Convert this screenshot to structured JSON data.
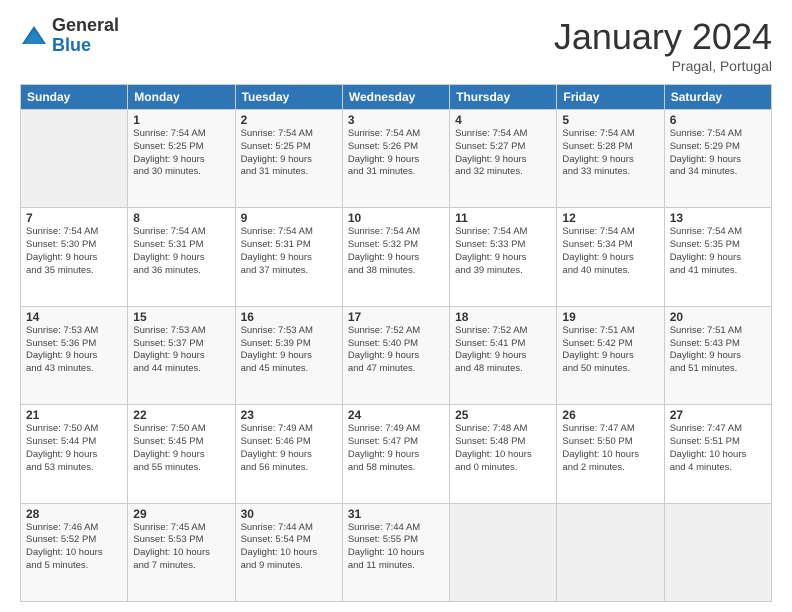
{
  "logo": {
    "general": "General",
    "blue": "Blue"
  },
  "title": "January 2024",
  "subtitle": "Pragal, Portugal",
  "days_header": [
    "Sunday",
    "Monday",
    "Tuesday",
    "Wednesday",
    "Thursday",
    "Friday",
    "Saturday"
  ],
  "weeks": [
    [
      {
        "num": "",
        "info": ""
      },
      {
        "num": "1",
        "info": "Sunrise: 7:54 AM\nSunset: 5:25 PM\nDaylight: 9 hours\nand 30 minutes."
      },
      {
        "num": "2",
        "info": "Sunrise: 7:54 AM\nSunset: 5:25 PM\nDaylight: 9 hours\nand 31 minutes."
      },
      {
        "num": "3",
        "info": "Sunrise: 7:54 AM\nSunset: 5:26 PM\nDaylight: 9 hours\nand 31 minutes."
      },
      {
        "num": "4",
        "info": "Sunrise: 7:54 AM\nSunset: 5:27 PM\nDaylight: 9 hours\nand 32 minutes."
      },
      {
        "num": "5",
        "info": "Sunrise: 7:54 AM\nSunset: 5:28 PM\nDaylight: 9 hours\nand 33 minutes."
      },
      {
        "num": "6",
        "info": "Sunrise: 7:54 AM\nSunset: 5:29 PM\nDaylight: 9 hours\nand 34 minutes."
      }
    ],
    [
      {
        "num": "7",
        "info": "Sunrise: 7:54 AM\nSunset: 5:30 PM\nDaylight: 9 hours\nand 35 minutes."
      },
      {
        "num": "8",
        "info": "Sunrise: 7:54 AM\nSunset: 5:31 PM\nDaylight: 9 hours\nand 36 minutes."
      },
      {
        "num": "9",
        "info": "Sunrise: 7:54 AM\nSunset: 5:31 PM\nDaylight: 9 hours\nand 37 minutes."
      },
      {
        "num": "10",
        "info": "Sunrise: 7:54 AM\nSunset: 5:32 PM\nDaylight: 9 hours\nand 38 minutes."
      },
      {
        "num": "11",
        "info": "Sunrise: 7:54 AM\nSunset: 5:33 PM\nDaylight: 9 hours\nand 39 minutes."
      },
      {
        "num": "12",
        "info": "Sunrise: 7:54 AM\nSunset: 5:34 PM\nDaylight: 9 hours\nand 40 minutes."
      },
      {
        "num": "13",
        "info": "Sunrise: 7:54 AM\nSunset: 5:35 PM\nDaylight: 9 hours\nand 41 minutes."
      }
    ],
    [
      {
        "num": "14",
        "info": "Sunrise: 7:53 AM\nSunset: 5:36 PM\nDaylight: 9 hours\nand 43 minutes."
      },
      {
        "num": "15",
        "info": "Sunrise: 7:53 AM\nSunset: 5:37 PM\nDaylight: 9 hours\nand 44 minutes."
      },
      {
        "num": "16",
        "info": "Sunrise: 7:53 AM\nSunset: 5:39 PM\nDaylight: 9 hours\nand 45 minutes."
      },
      {
        "num": "17",
        "info": "Sunrise: 7:52 AM\nSunset: 5:40 PM\nDaylight: 9 hours\nand 47 minutes."
      },
      {
        "num": "18",
        "info": "Sunrise: 7:52 AM\nSunset: 5:41 PM\nDaylight: 9 hours\nand 48 minutes."
      },
      {
        "num": "19",
        "info": "Sunrise: 7:51 AM\nSunset: 5:42 PM\nDaylight: 9 hours\nand 50 minutes."
      },
      {
        "num": "20",
        "info": "Sunrise: 7:51 AM\nSunset: 5:43 PM\nDaylight: 9 hours\nand 51 minutes."
      }
    ],
    [
      {
        "num": "21",
        "info": "Sunrise: 7:50 AM\nSunset: 5:44 PM\nDaylight: 9 hours\nand 53 minutes."
      },
      {
        "num": "22",
        "info": "Sunrise: 7:50 AM\nSunset: 5:45 PM\nDaylight: 9 hours\nand 55 minutes."
      },
      {
        "num": "23",
        "info": "Sunrise: 7:49 AM\nSunset: 5:46 PM\nDaylight: 9 hours\nand 56 minutes."
      },
      {
        "num": "24",
        "info": "Sunrise: 7:49 AM\nSunset: 5:47 PM\nDaylight: 9 hours\nand 58 minutes."
      },
      {
        "num": "25",
        "info": "Sunrise: 7:48 AM\nSunset: 5:48 PM\nDaylight: 10 hours\nand 0 minutes."
      },
      {
        "num": "26",
        "info": "Sunrise: 7:47 AM\nSunset: 5:50 PM\nDaylight: 10 hours\nand 2 minutes."
      },
      {
        "num": "27",
        "info": "Sunrise: 7:47 AM\nSunset: 5:51 PM\nDaylight: 10 hours\nand 4 minutes."
      }
    ],
    [
      {
        "num": "28",
        "info": "Sunrise: 7:46 AM\nSunset: 5:52 PM\nDaylight: 10 hours\nand 5 minutes."
      },
      {
        "num": "29",
        "info": "Sunrise: 7:45 AM\nSunset: 5:53 PM\nDaylight: 10 hours\nand 7 minutes."
      },
      {
        "num": "30",
        "info": "Sunrise: 7:44 AM\nSunset: 5:54 PM\nDaylight: 10 hours\nand 9 minutes."
      },
      {
        "num": "31",
        "info": "Sunrise: 7:44 AM\nSunset: 5:55 PM\nDaylight: 10 hours\nand 11 minutes."
      },
      {
        "num": "",
        "info": ""
      },
      {
        "num": "",
        "info": ""
      },
      {
        "num": "",
        "info": ""
      }
    ]
  ]
}
